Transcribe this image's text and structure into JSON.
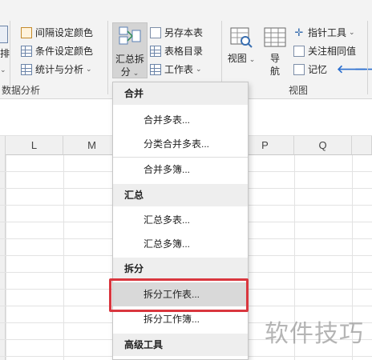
{
  "ribbon": {
    "left_partial": {
      "row1": "",
      "row2": "排"
    },
    "analysis_group": {
      "items": [
        {
          "label": "间隔设定颜色",
          "icon": "interval-color-icon"
        },
        {
          "label": "条件设定颜色",
          "icon": "condition-color-icon"
        },
        {
          "label": "统计与分析",
          "icon": "statistics-icon"
        }
      ],
      "group_label": "数据分析"
    },
    "merge_split": {
      "line1": "汇总拆",
      "line2": "分",
      "icon": "merge-split-icon"
    },
    "table_group": {
      "items": [
        {
          "label": "另存本表",
          "icon": "save-sheet-icon"
        },
        {
          "label": "表格目录",
          "icon": "table-catalog-icon"
        },
        {
          "label": "工作表",
          "icon": "worksheet-icon"
        }
      ]
    },
    "view_group": {
      "view_label": "视图",
      "nav_label_1": "导",
      "nav_label_2": "航",
      "pointer_tool": "指针工具",
      "follow_value": "关注相同值",
      "memory": "记忆",
      "group_label": "视图"
    }
  },
  "columns": [
    "L",
    "M",
    "",
    "P",
    "Q"
  ],
  "menu": {
    "sections": [
      {
        "header": "合并",
        "items": [
          "合并多表...",
          "分类合并多表...",
          "合并多簿..."
        ]
      },
      {
        "header": "汇总",
        "items": [
          "汇总多表...",
          "汇总多簿..."
        ]
      },
      {
        "header": "拆分",
        "items": [
          "拆分工作表...",
          "拆分工作簿..."
        ]
      },
      {
        "header": "高级工具",
        "items": []
      }
    ],
    "active_item": "拆分工作表..."
  },
  "watermark": "软件技巧"
}
